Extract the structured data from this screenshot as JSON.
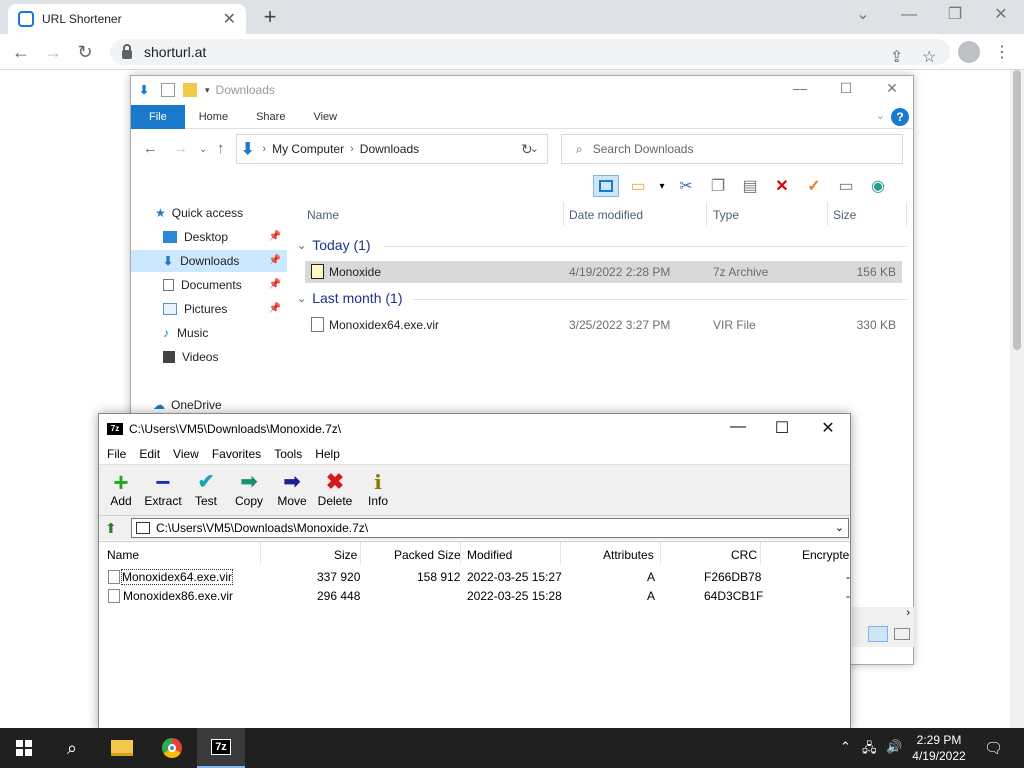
{
  "browser": {
    "tab_title": "URL Shortener",
    "url": "shorturl.at"
  },
  "explorer": {
    "title": "Downloads",
    "ribbon_tabs": [
      "File",
      "Home",
      "Share",
      "View"
    ],
    "breadcrumb": [
      "My Computer",
      "Downloads"
    ],
    "search_placeholder": "Search Downloads",
    "nav": {
      "quick_access": "Quick access",
      "items": [
        "Desktop",
        "Downloads",
        "Documents",
        "Pictures",
        "Music",
        "Videos"
      ],
      "onedrive": "OneDrive"
    },
    "columns": [
      "Name",
      "Date modified",
      "Type",
      "Size"
    ],
    "groups": [
      {
        "label": "Today (1)",
        "files": [
          {
            "name": "Monoxide",
            "date": "4/19/2022 2:28 PM",
            "type": "7z Archive",
            "size": "156 KB"
          }
        ]
      },
      {
        "label": "Last month (1)",
        "files": [
          {
            "name": "Monoxidex64.exe.vir",
            "date": "3/25/2022 3:27 PM",
            "type": "VIR File",
            "size": "330 KB"
          }
        ]
      }
    ]
  },
  "sevenzip": {
    "title": "C:\\Users\\VM5\\Downloads\\Monoxide.7z\\",
    "logo": "7z",
    "menu": [
      "File",
      "Edit",
      "View",
      "Favorites",
      "Tools",
      "Help"
    ],
    "toolbar": [
      "Add",
      "Extract",
      "Test",
      "Copy",
      "Move",
      "Delete",
      "Info"
    ],
    "path": "C:\\Users\\VM5\\Downloads\\Monoxide.7z\\",
    "columns": [
      "Name",
      "Size",
      "Packed Size",
      "Modified",
      "Attributes",
      "CRC",
      "Encrypte"
    ],
    "rows": [
      {
        "name": "Monoxidex64.exe.vir",
        "size": "337 920",
        "packed": "158 912",
        "modified": "2022-03-25 15:27",
        "attr": "A",
        "crc": "F266DB78",
        "enc": "-"
      },
      {
        "name": "Monoxidex86.exe.vir",
        "size": "296 448",
        "packed": "",
        "modified": "2022-03-25 15:28",
        "attr": "A",
        "crc": "64D3CB1F",
        "enc": "-"
      }
    ]
  },
  "taskbar": {
    "time": "2:29 PM",
    "date": "4/19/2022",
    "active_app_label": "7z"
  },
  "colors": {
    "accent": "#1979ca",
    "selection": "#cce8ff"
  }
}
